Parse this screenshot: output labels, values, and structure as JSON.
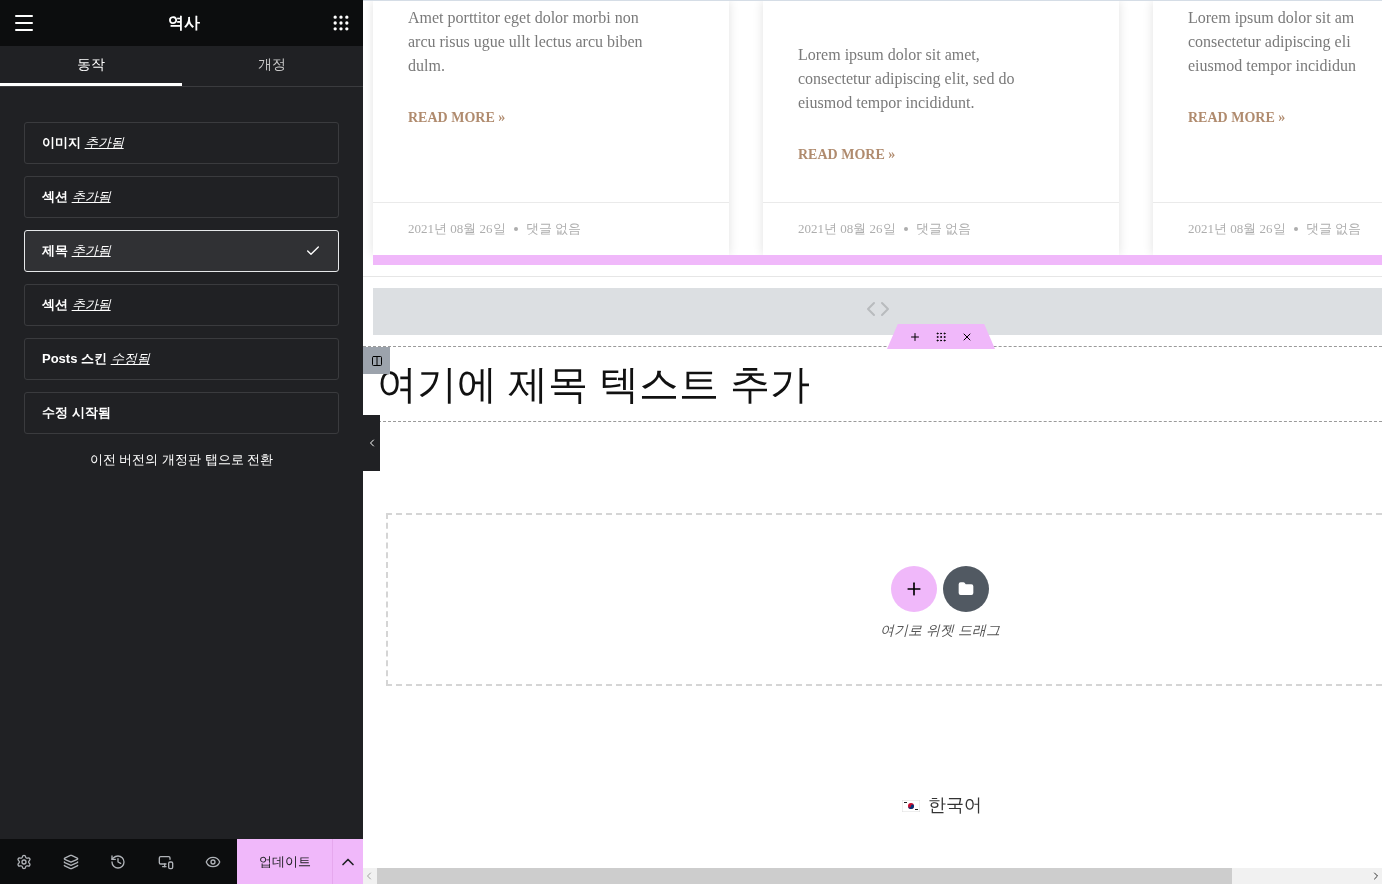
{
  "panel": {
    "title": "역사",
    "tabs": [
      {
        "label": "동작",
        "selected": true
      },
      {
        "label": "개정",
        "selected": false
      }
    ],
    "items": [
      {
        "title": "이미지",
        "action": "추가됨",
        "selected": false
      },
      {
        "title": "섹션",
        "action": "추가됨",
        "selected": false
      },
      {
        "title": "제목",
        "action": "추가됨",
        "selected": true
      },
      {
        "title": "섹션",
        "action": "추가됨",
        "selected": false
      },
      {
        "title": "Posts 스킨",
        "action": "수정됨",
        "selected": false
      },
      {
        "title": "수정 시작됨",
        "selected": false
      }
    ],
    "switch_link": "이전 버전의 개정판 탭으로 전환",
    "footer": {
      "update_button": "업데이트"
    }
  },
  "canvas": {
    "cards": [
      {
        "body": [
          "Amet porttitor eget dolor morbi non",
          "arcu risus ugue ullt lectus arcu biben",
          "dulm."
        ],
        "read_more": "READ MORE »",
        "date": "2021년 08월 26일",
        "comments": "댓글 없음"
      },
      {
        "body": [
          "Lorem ipsum dolor sit amet,",
          "consectetur adipiscing elit, sed do",
          "eiusmod tempor incididunt."
        ],
        "read_more": "READ MORE »",
        "date": "2021년 08월 26일",
        "comments": "댓글 없음"
      },
      {
        "body": [
          "Lorem ipsum dolor sit am",
          "consectetur adipiscing eli",
          "eiusmod tempor incididun"
        ],
        "read_more": "READ MORE »",
        "date": "2021년 08월 26일",
        "comments": "댓글 없음"
      }
    ],
    "heading": "여기에 제목 텍스트 추가",
    "drop_hint": "여기로 위젯 드래그",
    "language": "한국어"
  }
}
